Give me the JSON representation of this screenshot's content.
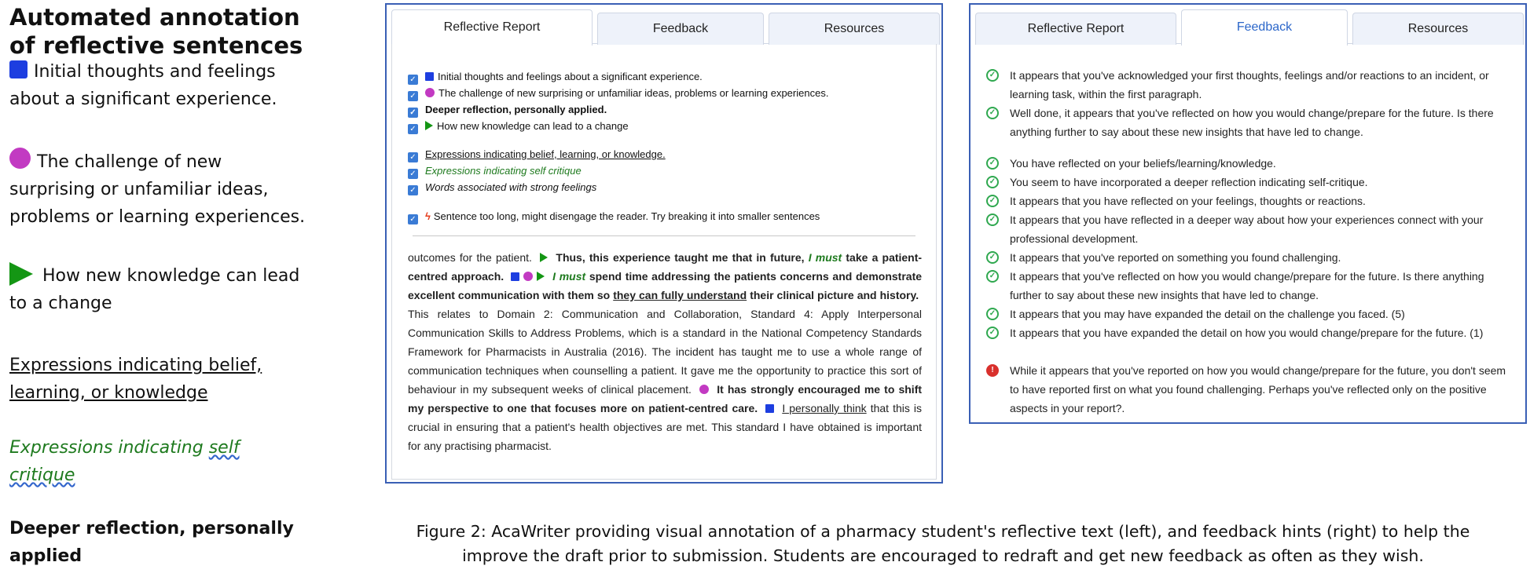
{
  "legend": {
    "title_line1": "Automated annotation",
    "title_line2": "of reflective sentences",
    "item1": "Initial thoughts and feelings about a significant experience.",
    "item2": "The challenge of new surprising or unfamiliar ideas, problems or learning experiences.",
    "item3": "How new knowledge can lead to a change",
    "item4": "Expressions indicating belief, learning, or knowledge",
    "item5_a": "Expressions indicating ",
    "item5_b": "self critique",
    "item6": "Deeper reflection, personally applied"
  },
  "report_panel": {
    "tabs": [
      "Reflective Report",
      "Feedback",
      "Resources"
    ],
    "checks": {
      "c1": "Initial thoughts and feelings about a significant experience.",
      "c2": "The challenge of new surprising or unfamiliar ideas, problems or learning experiences.",
      "c3": "Deeper reflection, personally applied.",
      "c4": "How new knowledge can lead to a change",
      "c5": "Expressions indicating belief, learning, or knowledge.",
      "c6": "Expressions indicating self critique",
      "c7": "Words associated with strong feelings",
      "c8": "Sentence too long, might disengage the reader. Try breaking it into smaller sentences"
    },
    "text": {
      "t1": "outcomes for the patient.",
      "t2": "Thus, this experience taught me that in future,",
      "t3": "I must",
      "t4": "take a patient-centred approach.",
      "t5": "I must",
      "t6": "spend time addressing the patients concerns and demonstrate excellent communication with them so",
      "t7": "they can fully understand",
      "t8": "their clinical picture and history.",
      "t9": "This relates to Domain 2: Communication and Collaboration, Standard 4: Apply Interpersonal Communication Skills to Address Problems, which is a standard in the National Competency Standards Framework for Pharmacists in Australia (2016).  The incident has taught me to use a whole range of communication techniques when counselling a patient.  It gave me the opportunity to practice this sort of behaviour in my subsequent weeks of clinical placement.",
      "t10": "It has strongly encouraged me to shift my perspective to one that focuses more on patient-centred care.",
      "t11": "I personally think",
      "t12": "that this is crucial in ensuring that a patient's health objectives are met.  This standard I have obtained is important for any practising pharmacist."
    }
  },
  "feedback_panel": {
    "tabs": [
      "Reflective Report",
      "Feedback",
      "Resources"
    ],
    "items": [
      "It appears that you've acknowledged your first thoughts, feelings and/or reactions to an incident, or learning task, within the first paragraph.",
      "Well done, it appears that you've reflected on how you would change/prepare for the future. Is there anything further to say about these new insights that have led to change.",
      "You have reflected on your beliefs/learning/knowledge.",
      "You seem to have incorporated a deeper reflection indicating self-critique.",
      "It appears that you have reflected on your feelings, thoughts or reactions.",
      "It appears that you have reflected in a deeper way about how your experiences connect with your professional development.",
      "It appears that you've reported on something you found challenging.",
      "It appears that you've reflected on how you would change/prepare for the future. Is there anything further to say about these new insights that have led to change.",
      "It appears that you may have expanded the detail on the challenge you faced. (5)",
      "It appears that you have expanded the detail on how you would change/prepare for the future. (1)",
      "While it appears that you've reported on how you would change/prepare for the future, you don't seem to have reported first on what you found challenging. Perhaps you've reflected only on the positive aspects in your report?."
    ]
  },
  "caption": {
    "line1": "Figure 2: AcaWriter providing visual annotation of a pharmacy student's reflective text (left), and feedback hints (right) to help the",
    "line2": "improve the draft prior to submission. Students are encouraged to redraft and get new feedback as often as they wish."
  },
  "colors": {
    "square": "#1d3ee0",
    "circle": "#c23ac2",
    "triangle": "#149614",
    "panel_border": "#3a5fb5",
    "success": "#2fa84f",
    "warning": "#d9302c"
  }
}
